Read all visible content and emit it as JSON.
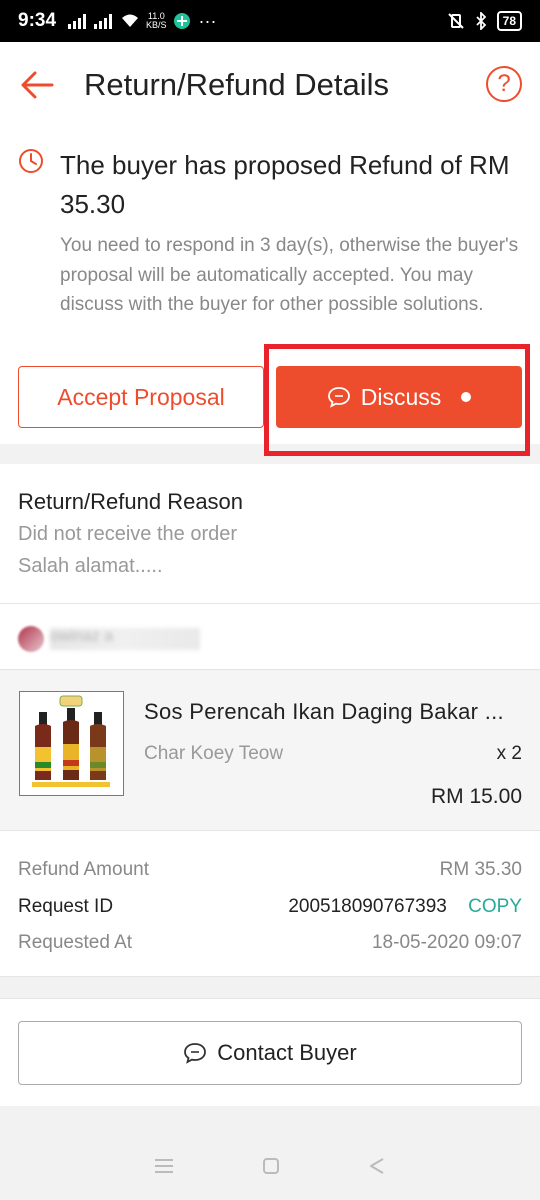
{
  "status_bar": {
    "time": "9:34",
    "net_speed_value": "11.0",
    "net_speed_unit": "KB/S",
    "battery": "78",
    "more": "···"
  },
  "header": {
    "title": "Return/Refund Details",
    "help_glyph": "?"
  },
  "proposal": {
    "title": "The buyer has proposed Refund of RM 35.30",
    "description": "You need to respond in 3 day(s), otherwise the buyer's proposal will be automatically accepted. You may discuss with the buyer for other possible solutions.",
    "accept_label": "Accept Proposal",
    "discuss_label": "Discuss"
  },
  "reason": {
    "title": "Return/Refund Reason",
    "lines": [
      "Did not receive the order",
      "Salah alamat....."
    ]
  },
  "buyer": {
    "name_blurred": "owinaz a"
  },
  "product": {
    "name": "Sos Perencah Ikan Daging Bakar ...",
    "variant": "Char Koey Teow",
    "quantity": "x 2",
    "price": "RM 15.00"
  },
  "info": {
    "refund_amount_label": "Refund Amount",
    "refund_amount_value": "RM 35.30",
    "request_id_label": "Request ID",
    "request_id_value": "200518090767393",
    "copy_label": "COPY",
    "requested_at_label": "Requested At",
    "requested_at_value": "18-05-2020 09:07"
  },
  "contact": {
    "label": "Contact Buyer"
  },
  "colors": {
    "brand": "#ee4d2d",
    "copy": "#26aa99",
    "highlight": "#e8232a"
  },
  "icons": [
    "back-arrow-icon",
    "help-icon",
    "clock-icon",
    "chat-bubble-icon",
    "menu-icon",
    "home-icon",
    "back-triangle-icon"
  ]
}
